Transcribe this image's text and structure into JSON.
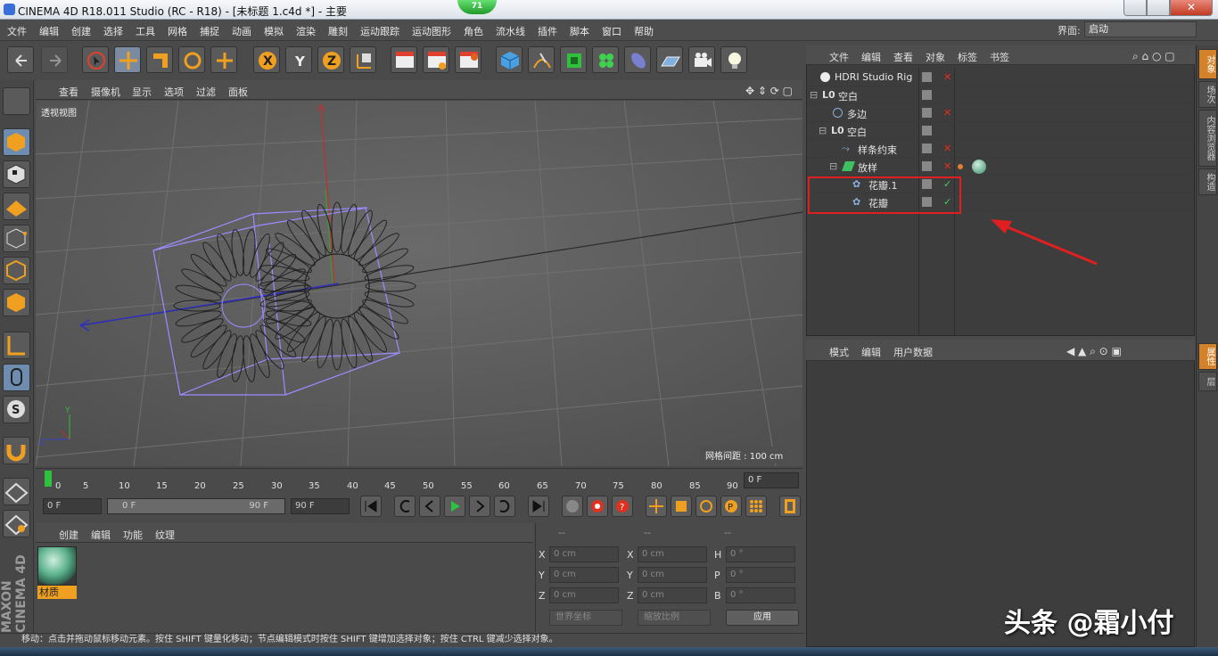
{
  "window": {
    "title": "CINEMA 4D R18.011 Studio (RC - R18) - [未标题 1.c4d *] - 主要",
    "fps": "71",
    "close": "✕"
  },
  "menu": [
    "文件",
    "编辑",
    "创建",
    "选择",
    "工具",
    "网格",
    "捕捉",
    "动画",
    "模拟",
    "渲染",
    "雕刻",
    "运动跟踪",
    "运动图形",
    "角色",
    "流水线",
    "插件",
    "脚本",
    "窗口",
    "帮助"
  ],
  "layout": {
    "label": "界面:",
    "value": "启动"
  },
  "viewport": {
    "menu": [
      "查看",
      "摄像机",
      "显示",
      "选项",
      "过滤",
      "面板"
    ],
    "view_name": "透视视图",
    "grid_spacing": "网格间距 : 100 cm"
  },
  "timeline": {
    "ticks": [
      "0",
      "5",
      "10",
      "15",
      "20",
      "25",
      "30",
      "35",
      "40",
      "45",
      "50",
      "55",
      "60",
      "65",
      "70",
      "75",
      "80",
      "85",
      "90"
    ],
    "current": "0 F"
  },
  "transport": {
    "start": "0 F",
    "range_start": "0 F",
    "range_end": "90 F",
    "end": "90 F"
  },
  "materials": {
    "menu": [
      "创建",
      "编辑",
      "功能",
      "纹理"
    ],
    "item": "材质"
  },
  "coords": {
    "headers": [
      "--",
      "--",
      "--"
    ],
    "rows": [
      {
        "a": "X",
        "av": "0 cm",
        "b": "X",
        "bv": "0 cm",
        "c": "H",
        "cv": "0 °"
      },
      {
        "a": "Y",
        "av": "0 cm",
        "b": "Y",
        "bv": "0 cm",
        "c": "P",
        "cv": "0 °"
      },
      {
        "a": "Z",
        "av": "0 cm",
        "b": "Z",
        "bv": "0 cm",
        "c": "B",
        "cv": "0 °"
      }
    ],
    "world": "世界坐标",
    "scale": "缩放比例",
    "apply": "应用"
  },
  "status": "移动：点击并拖动鼠标移动元素。按住 SHIFT 键量化移动；节点编辑模式时按住 SHIFT 键增加选择对象；按住 CTRL 键减少选择对象。",
  "objects": {
    "menu": [
      "文件",
      "编辑",
      "查看",
      "对象",
      "标签",
      "书签"
    ],
    "rows": [
      {
        "name": "HDRI Studio Rig",
        "state": "✕"
      },
      {
        "name": "空白",
        "state": ""
      },
      {
        "name": "多边",
        "state": "✕"
      },
      {
        "name": "空白",
        "state": ""
      },
      {
        "name": "样条约束",
        "state": "✕"
      },
      {
        "name": "放样",
        "state": "✕"
      },
      {
        "name": "花瓣.1",
        "state": "✓"
      },
      {
        "name": "花瓣",
        "state": "✓"
      }
    ]
  },
  "attributes": {
    "menu": [
      "模式",
      "编辑",
      "用户数据"
    ]
  },
  "side_tabs": [
    "对象",
    "场次",
    "内容浏览器",
    "构造",
    "属性",
    "层"
  ],
  "brand": "MAXON CINEMA 4D",
  "watermark": "头条 @霜小付",
  "colors": {
    "accent": "#d4822a",
    "highlight_box": "#e02020",
    "cage": "#9a8cff"
  }
}
